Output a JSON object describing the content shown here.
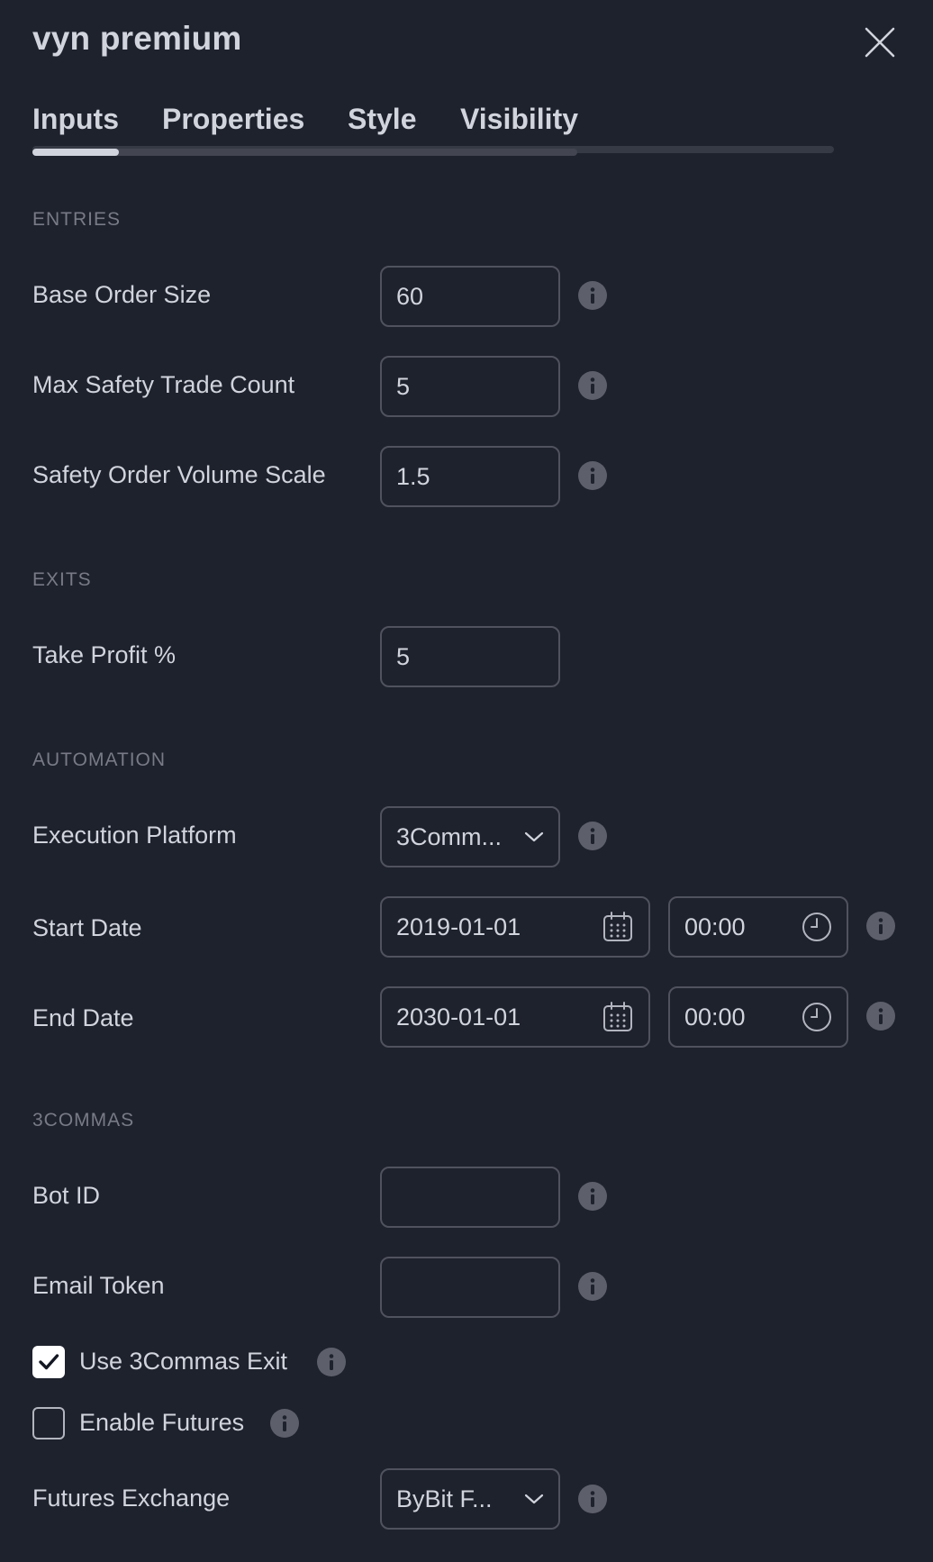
{
  "dialog": {
    "title": "vyn premium"
  },
  "tabs": [
    {
      "label": "Inputs",
      "active": true
    },
    {
      "label": "Properties",
      "active": false
    },
    {
      "label": "Style",
      "active": false
    },
    {
      "label": "Visibility",
      "active": false
    }
  ],
  "sections": {
    "entries": "ENTRIES",
    "exits": "EXITS",
    "automation": "AUTOMATION",
    "threecommas": "3COMMAS"
  },
  "fields": {
    "base_order_size": {
      "label": "Base Order Size",
      "value": "60"
    },
    "max_safety_trade_count": {
      "label": "Max Safety Trade Count",
      "value": "5"
    },
    "safety_order_volume_scale": {
      "label": "Safety Order Volume Scale",
      "value": "1.5"
    },
    "take_profit": {
      "label": "Take Profit %",
      "value": "5"
    },
    "execution_platform": {
      "label": "Execution Platform",
      "value": "3Comm..."
    },
    "start_date": {
      "label": "Start Date",
      "date": "2019-01-01",
      "time": "00:00"
    },
    "end_date": {
      "label": "End Date",
      "date": "2030-01-01",
      "time": "00:00"
    },
    "bot_id": {
      "label": "Bot ID",
      "value": ""
    },
    "email_token": {
      "label": "Email Token",
      "value": ""
    },
    "use_3commas_exit": {
      "label": "Use 3Commas Exit",
      "checked": true
    },
    "enable_futures": {
      "label": "Enable Futures",
      "checked": false
    },
    "futures_exchange": {
      "label": "Futures Exchange",
      "value": "ByBit F..."
    }
  },
  "icons": {
    "close": "close-icon",
    "info": "info-icon",
    "calendar": "calendar-icon",
    "clock": "clock-icon",
    "chevron": "chevron-down-icon",
    "check": "checkmark-icon"
  },
  "colors": {
    "background": "#1e222d",
    "text": "#d1d4dc",
    "muted": "#787b86",
    "border": "#50535e",
    "info_icon": "#5d606b"
  }
}
